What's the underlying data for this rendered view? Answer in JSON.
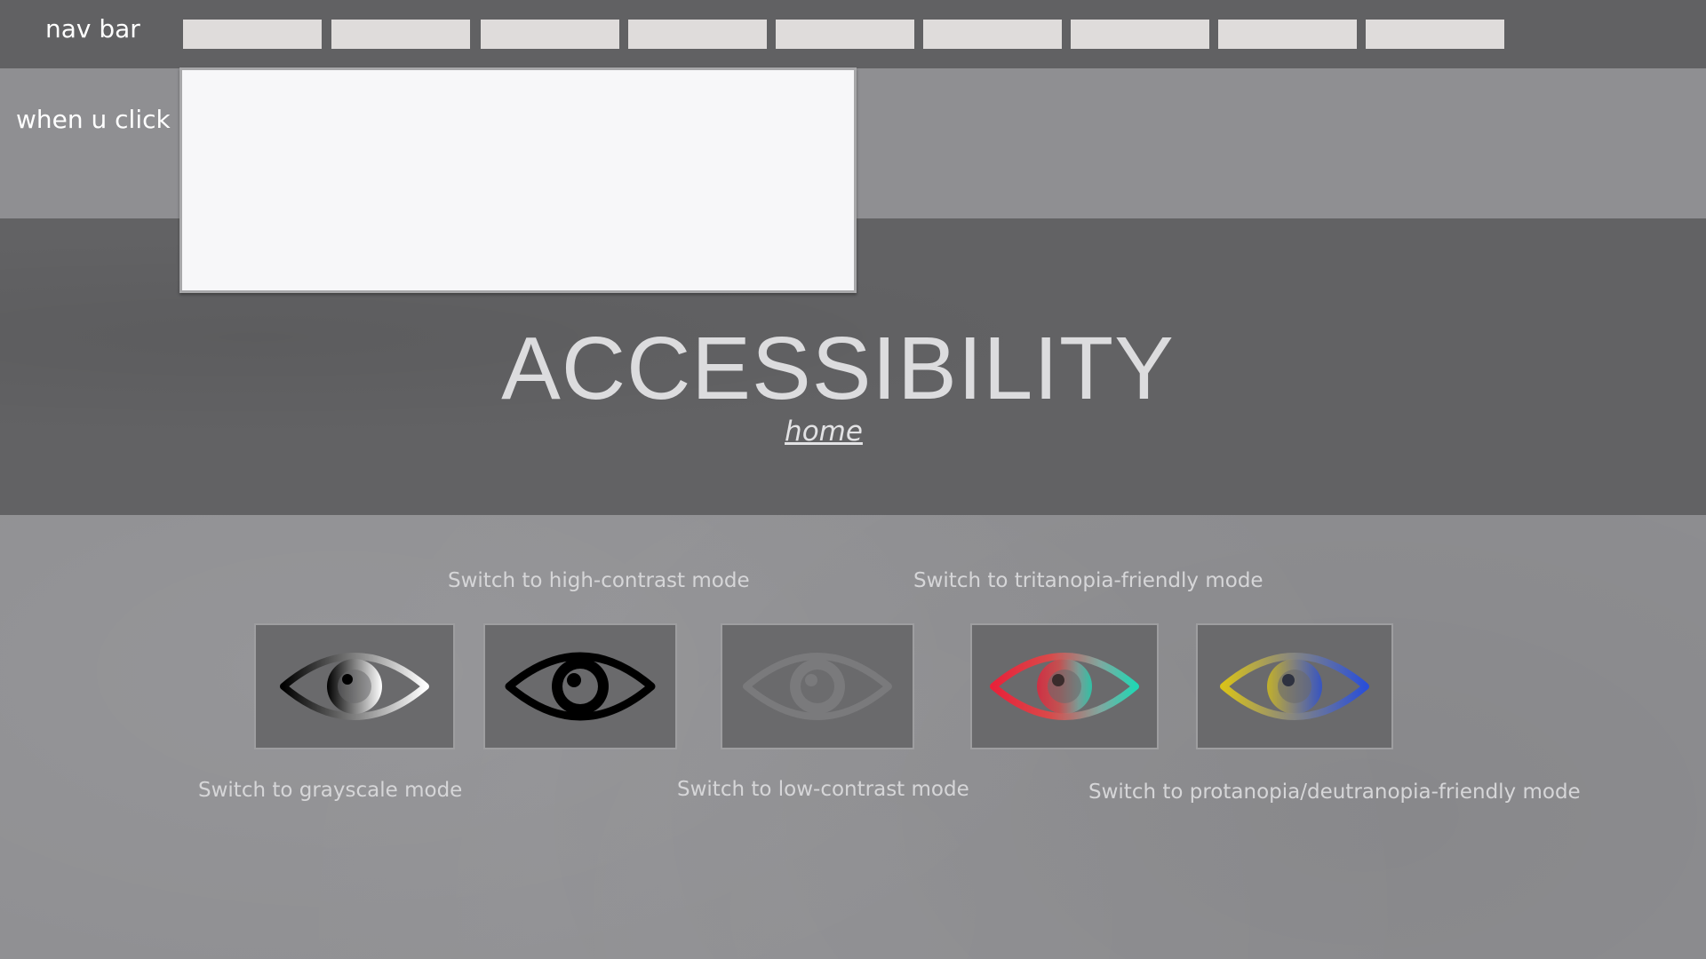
{
  "navbar": {
    "label": "nav bar",
    "items": [
      "",
      "",
      "",
      "",
      "",
      "",
      "",
      "",
      ""
    ]
  },
  "dropdown": {
    "label": "when u click"
  },
  "hero": {
    "title": "ACCESSIBILITY",
    "home_link": "home"
  },
  "modes": {
    "high_contrast_caption": "Switch to high-contrast mode",
    "tritanopia_caption": "Switch to tritanopia-friendly mode",
    "grayscale_caption": "Switch to grayscale mode",
    "low_contrast_caption": "Switch to low-contrast mode",
    "protanopia_caption": "Switch to protanopia/deutranopia-friendly mode",
    "buttons": [
      {
        "icon": "eye-grayscale-icon"
      },
      {
        "icon": "eye-high-contrast-icon"
      },
      {
        "icon": "eye-low-contrast-icon"
      },
      {
        "icon": "eye-tritanopia-icon"
      },
      {
        "icon": "eye-protanopia-icon"
      }
    ]
  },
  "colors": {
    "background": "#8f8f92",
    "navbar": "#616163",
    "hero_band": "#626264",
    "nav_item": "#dfdcdb",
    "panel": "#f7f7f9"
  }
}
